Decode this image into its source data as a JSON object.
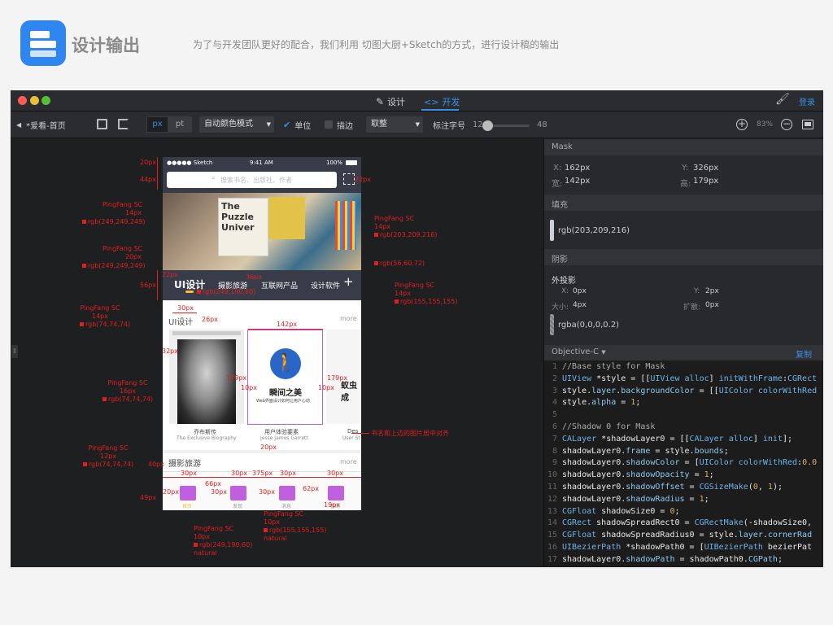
{
  "header": {
    "title": "设计输出",
    "subtitle": "为了与开发团队更好的配合，我们利用 切图大厨+Sketch的方式，进行设计稿的输出"
  },
  "window": {
    "tabs": {
      "design": "设计",
      "dev": "开发"
    },
    "login": "登录"
  },
  "toolbar": {
    "back_label": "*爱看-首页",
    "unit_px": "px",
    "unit_pt": "pt",
    "color_mode": "自动颜色模式",
    "unit_check": "单位",
    "stroke_check": "描边",
    "rounding": "取整",
    "font_label": "标注字号",
    "font_min": "12",
    "font_max": "48",
    "font_level": 0.05,
    "zoom": "83%"
  },
  "phone": {
    "carrier": "●●●●● Sketch",
    "time": "9:41 AM",
    "battery": "100%",
    "search_placeholder": "搜索书名、出版社、作者",
    "categories": [
      "UI设计",
      "摄影旅游",
      "互联网产品",
      "设计软件"
    ],
    "section1": "UI设计",
    "more": "more",
    "books": [
      {
        "title": "乔布斯传",
        "subtitle": "The Exclusive Biography"
      },
      {
        "title": "用户体验要素",
        "subtitle": "Jesse James Garrett"
      },
      {
        "title": "Des",
        "subtitle": "User St"
      }
    ],
    "book2_cover_title": "瞬间之美",
    "book2_cover_sub": "Web界面设计如何让用户心动",
    "book3_cover_title": "蚁虫成",
    "section2": "摄影旅游",
    "tab_labels": [
      "首页",
      "发现",
      "消息",
      "我的"
    ]
  },
  "annotations": {
    "d20": "20px",
    "d44": "44px",
    "d22": "22px",
    "d56": "56px",
    "d36": "36px",
    "d30": "30px",
    "d26": "26px",
    "d142": "142px",
    "d179": "179px",
    "d10": "10px",
    "d32": "32px",
    "d179b": "179px",
    "d10b": "10px",
    "d20b": "20px",
    "d40": "40px",
    "d30b": "30px",
    "d66": "66px",
    "d30c": "30px",
    "d375": "375px",
    "d30d": "30px",
    "d49": "49px",
    "d20c": "20px",
    "d30e": "30px",
    "d30f": "30px",
    "d62": "62px",
    "d19": "19px",
    "d30g": "30px",
    "d10c": "10px",
    "d22b": "22px",
    "l1": [
      "PingFang SC",
      "14px",
      "rgb(249,249,249)"
    ],
    "l2": [
      "PingFang SC",
      "20px",
      "rgb(249,249,249)"
    ],
    "l3": [
      "PingFang SC",
      "14px",
      "rgb(74,74,74)"
    ],
    "l4": [
      "PingFang SC",
      "16px",
      "rgb(74,74,74)"
    ],
    "l5": [
      "PingFang SC",
      "12px",
      "rgb(74,74,74)"
    ],
    "r1": [
      "PingFang SC",
      "14px",
      "rgb(203,209,216)"
    ],
    "r2": "rgb(56,60,72)",
    "r3": [
      "PingFang SC",
      "14px",
      "rgb(155,155,155)"
    ],
    "cat_color": "rgb(249,190,60)",
    "note_align": "书名和上边的图片居中对齐",
    "b1": [
      "PingFang SC",
      "10px",
      "rgb(249,190,60)",
      "natural"
    ],
    "b2": [
      "PingFang SC",
      "10px",
      "rgb(155,155,155)",
      "natural"
    ]
  },
  "panel": {
    "section_mask": "Mask",
    "x_label": "X:",
    "x_value": "162px",
    "y_label": "Y:",
    "y_value": "326px",
    "w_label": "宽:",
    "w_value": "142px",
    "h_label": "高:",
    "h_value": "179px",
    "section_fill": "填充",
    "fill_value": "rgb(203,209,216)",
    "section_shadow": "阴影",
    "outer_shadow": "外投影",
    "sx_label": "X:",
    "sx_value": "0px",
    "sy_label": "Y:",
    "sy_value": "2px",
    "size_label": "大小:",
    "size_value": "4px",
    "spread_label": "扩散:",
    "spread_value": "0px",
    "shadow_color": "rgba(0,0,0,0.2)",
    "lang": "Objective-C",
    "copy": "复制",
    "code": [
      "//Base style for Mask",
      "UIView *style = [[UIView alloc] initWithFrame:CGRect",
      "style.layer.backgroundColor = [[UIColor colorWithRed",
      "style.alpha = 1;",
      "",
      "//Shadow 0 for Mask",
      "CALayer *shadowLayer0 = [[CALayer alloc] init];",
      "shadowLayer0.frame = style.bounds;",
      "shadowLayer0.shadowColor = [UIColor colorWithRed:0.0",
      "shadowLayer0.shadowOpacity = 1;",
      "shadowLayer0.shadowOffset = CGSizeMake(0, 1);",
      "shadowLayer0.shadowRadius = 1;",
      "CGFloat shadowSize0 = 0;",
      "CGRect shadowSpreadRect0 = CGRectMake(-shadowSize0,",
      "CGFloat shadowSpreadRadius0 =  style.layer.cornerRad",
      "UIBezierPath *shadowPath0 = [UIBezierPath bezierPat",
      "shadowLayer0.shadowPath = shadowPath0.CGPath;"
    ]
  },
  "colors": {
    "accent": "#3a8ee6",
    "annotation": "#e02020",
    "window_bg": "#1e1f21",
    "panel_bg": "#28292c",
    "code_bg": "#1c1c1c"
  }
}
